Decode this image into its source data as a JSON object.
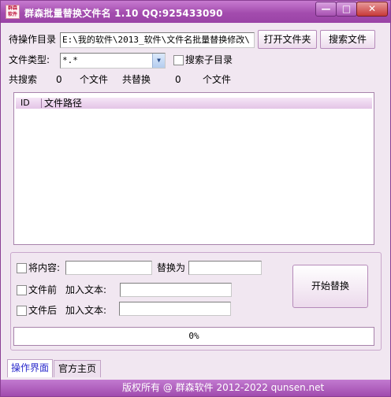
{
  "window": {
    "title": "群森批量替换文件名  1.10 QQ:925433090",
    "icon_text": "群森软件",
    "minimize": "—",
    "maximize": "□",
    "close": "✕"
  },
  "form": {
    "dir_label": "待操作目录",
    "dir_value": "E:\\我的软件\\2013_软件\\文件名批量替换修改\\",
    "open_folder_btn": "打开文件夹",
    "search_files_btn": "搜索文件",
    "type_label": "文件类型:",
    "type_value": "*.*",
    "subdir_label": "搜索子目录",
    "search_total_label": "共搜索",
    "search_total_value": "0",
    "files_unit_1": "个文件",
    "replace_total_label": "共替换",
    "replace_total_value": "0",
    "files_unit_2": "个文件"
  },
  "list": {
    "columns": [
      "ID",
      "文件路径"
    ]
  },
  "replace": {
    "content_label": "将内容:",
    "content_value": "",
    "replace_with_label": "替换为",
    "replace_with_value": "",
    "prefix_label": "文件前",
    "prefix_add_label": "加入文本:",
    "prefix_value": "",
    "suffix_label": "文件后",
    "suffix_add_label": "加入文本:",
    "suffix_value": "",
    "start_btn": "开始替换"
  },
  "progress": {
    "percent": 0,
    "text": "0%"
  },
  "tabs": [
    "操作界面",
    "官方主页"
  ],
  "status": {
    "text": "版权所有 @ 群森软件 2012-2022   qunsen.net"
  }
}
